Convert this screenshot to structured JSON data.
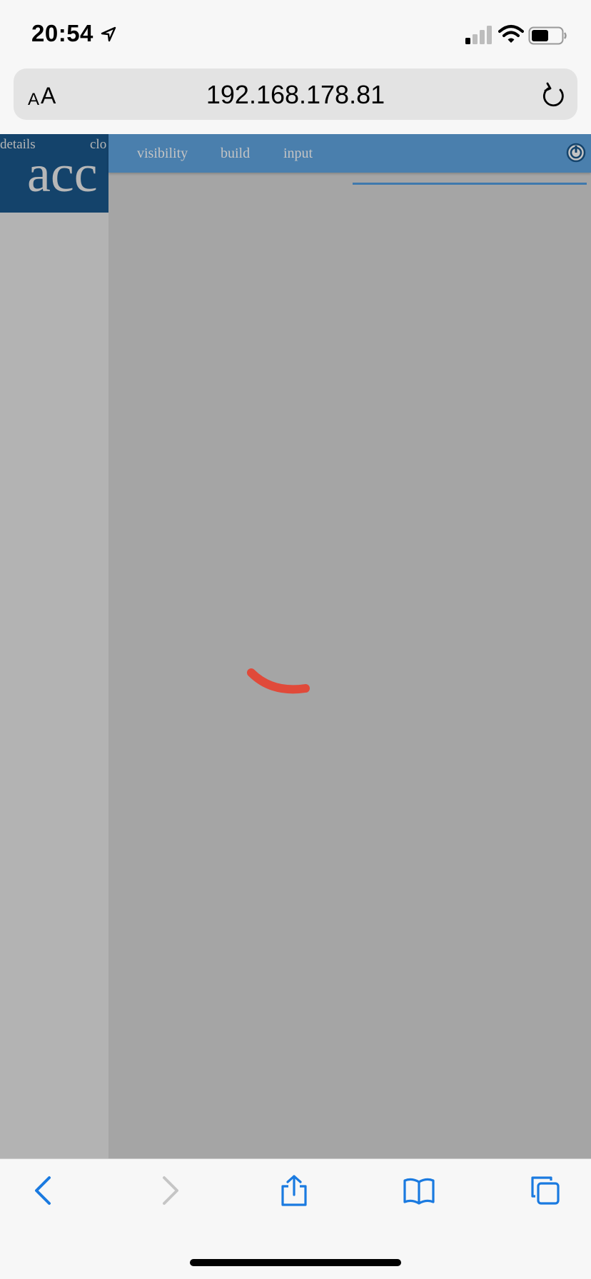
{
  "status_bar": {
    "time": "20:54"
  },
  "browser": {
    "aa_small": "A",
    "aa_big": "A",
    "url": "192.168.178.81"
  },
  "page": {
    "left_header": {
      "details": "details",
      "clo": "clo",
      "big_word": "acc"
    },
    "nav": {
      "items": [
        "visibility",
        "build",
        "input"
      ]
    },
    "colors": {
      "left_header_bg": "#14436b",
      "nav_bg": "#4a7fad",
      "spinner": "#e04a3a",
      "overlay": "#a5a5a5"
    }
  },
  "toolbar": {
    "icons": [
      "back-icon",
      "forward-icon",
      "share-icon",
      "bookmarks-icon",
      "tabs-icon"
    ]
  }
}
